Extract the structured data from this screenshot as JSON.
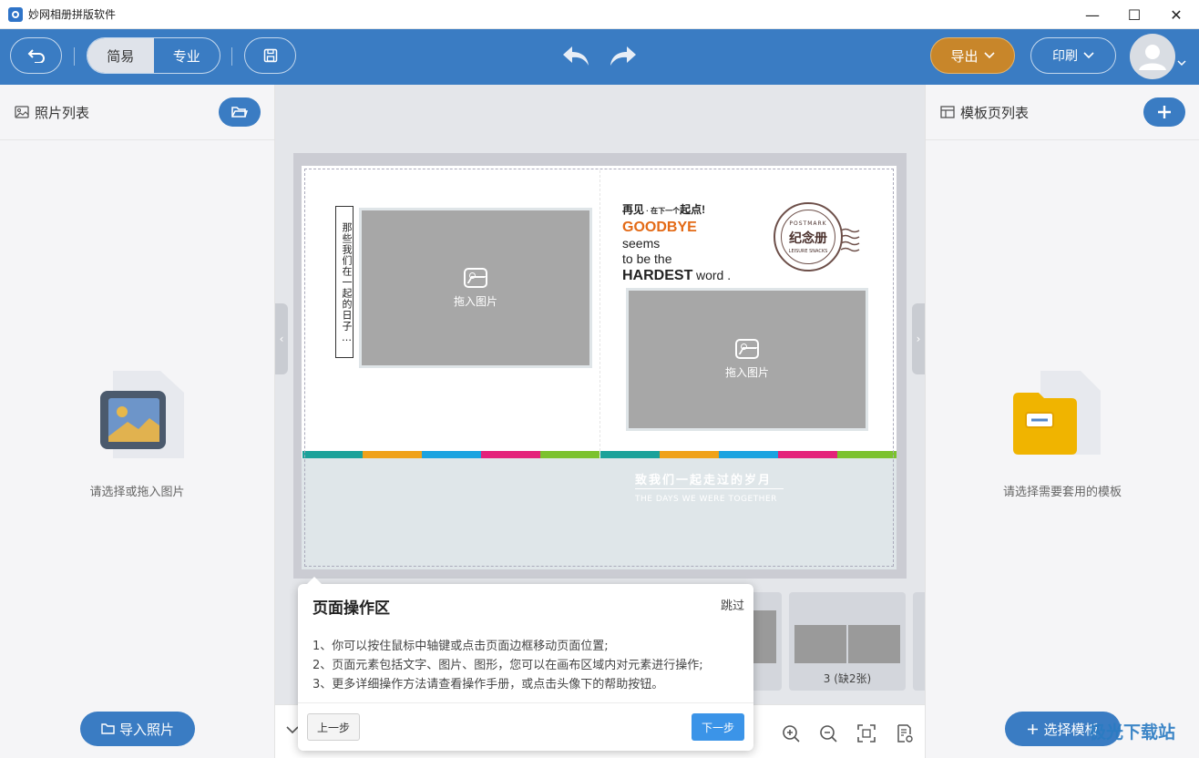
{
  "window": {
    "title": "妙网相册拼版软件",
    "controls": [
      "—",
      "☐",
      "✕"
    ]
  },
  "toolbar": {
    "mode_easy": "简易",
    "mode_pro": "专业",
    "export_label": "导出",
    "print_label": "印刷",
    "accent_color": "#3a7cc3",
    "export_color": "#c8862a"
  },
  "left_panel": {
    "title": "照片列表",
    "empty_text": "请选择或拖入图片",
    "import_button": "导入照片"
  },
  "right_panel": {
    "title": "模板页列表",
    "empty_text": "请选择需要套用的模板",
    "select_button": "选择模板"
  },
  "canvas": {
    "vertical_caption": "那些我们在一起的日子…",
    "photo_placeholder": "拖入图片",
    "goodbye_line1_a": "再见",
    "goodbye_line1_b": "在下一个",
    "goodbye_line1_c": "起点!",
    "goodbye_line2": "GOODBYE",
    "goodbye_line3": "seems",
    "goodbye_line4": "to be the",
    "goodbye_line5_a": "HARDEST",
    "goodbye_line5_b": "word .",
    "stamp_top": "POSTMARK",
    "stamp_center": "纪念册",
    "stamp_bottom": "LEISURE SNACKS",
    "band_title_cn": "致我们一起走过的岁月",
    "band_title_en": "THE DAYS WE WERE TOGETHER",
    "stripe_colors": [
      "#1ba29a",
      "#f0a21a",
      "#1aa3e0",
      "#e4227a",
      "#7cc22e"
    ]
  },
  "thumbnails": {
    "thumb3_label": "3 (缺2张)"
  },
  "guide": {
    "title": "页面操作区",
    "skip": "跳过",
    "line1": "1、你可以按住鼠标中轴键或点击页面边框移动页面位置;",
    "line2": "2、页面元素包括文字、图片、图形，您可以在画布区域内对元素进行操作;",
    "line3": "3、更多详细操作方法请查看操作手册，或点击头像下的帮助按钮。",
    "prev": "上一步",
    "next": "下一步"
  },
  "watermark": {
    "text": "极光下载站"
  }
}
